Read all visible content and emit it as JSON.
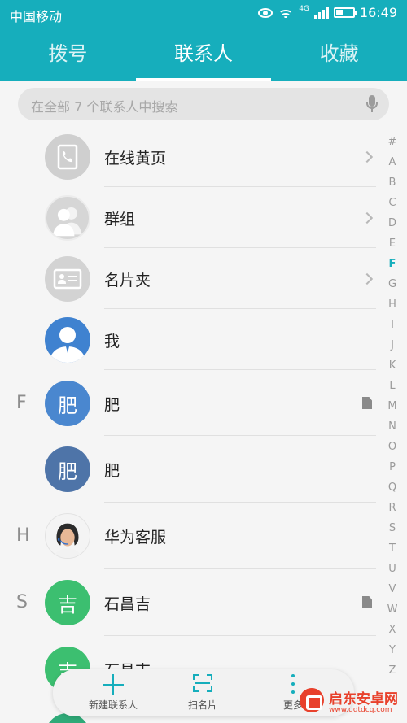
{
  "status_bar": {
    "carrier": "中国移动",
    "network": "4G",
    "time": "16:49"
  },
  "tabs": [
    {
      "label": "拨号",
      "active": false
    },
    {
      "label": "联系人",
      "active": true
    },
    {
      "label": "收藏",
      "active": false
    }
  ],
  "search": {
    "placeholder": "在全部 7 个联系人中搜索"
  },
  "groups": [
    {
      "label": "在线黄页",
      "icon": "phone-book-icon"
    },
    {
      "label": "群组",
      "icon": "group-icon"
    },
    {
      "label": "名片夹",
      "icon": "business-card-icon"
    }
  ],
  "me": {
    "label": "我",
    "icon": "person-silhouette-icon"
  },
  "contacts": [
    {
      "letter": "F",
      "avatar_text": "肥",
      "avatar_color": "#4a87cf",
      "name": "肥",
      "sim": true
    },
    {
      "letter": "",
      "avatar_text": "肥",
      "avatar_color": "#4e74a8",
      "name": "肥",
      "sim": false
    },
    {
      "letter": "H",
      "avatar_text": "",
      "avatar_color": "#ffffff",
      "name": "华为客服",
      "sim": false
    },
    {
      "letter": "S",
      "avatar_text": "吉",
      "avatar_color": "#3cbf70",
      "name": "石昌吉",
      "sim": true
    },
    {
      "letter": "",
      "avatar_text": "吉",
      "avatar_color": "#3cbf70",
      "name": "石昌吉",
      "sim": false
    }
  ],
  "index_letters": [
    "#",
    "A",
    "B",
    "C",
    "D",
    "E",
    "F",
    "G",
    "H",
    "I",
    "J",
    "K",
    "L",
    "M",
    "N",
    "O",
    "P",
    "Q",
    "R",
    "S",
    "T",
    "U",
    "V",
    "W",
    "X",
    "Y",
    "Z"
  ],
  "index_active": "F",
  "bottom_bar": {
    "new_contact": "新建联系人",
    "scan_card": "扫名片",
    "more": "更多"
  },
  "watermark": {
    "title": "启东安卓网",
    "url": "www.qdtdcq.com"
  },
  "colors": {
    "accent": "#16aebc",
    "sim_icon": "#8a8a8a"
  }
}
